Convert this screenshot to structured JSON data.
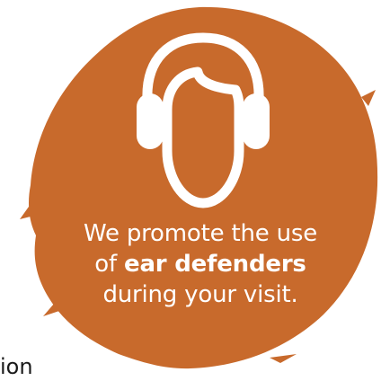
{
  "sign": {
    "background_color": "#c86a2c",
    "icon": "head-with-ear-defenders-icon",
    "message": {
      "line1": "We promote the use",
      "line2_prefix": "of ",
      "line2_bold": "ear defenders",
      "line3": "during your visit."
    }
  },
  "fragment_text": "ion"
}
